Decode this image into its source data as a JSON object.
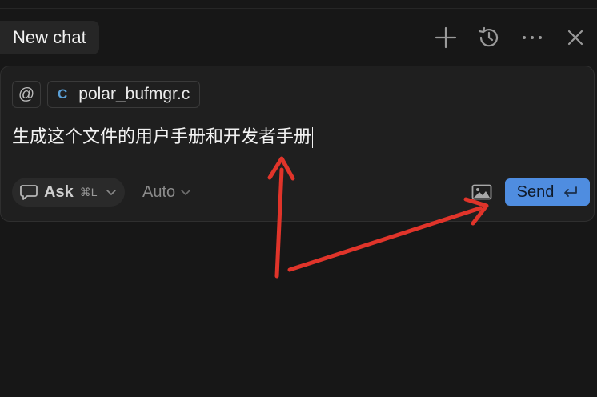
{
  "header": {
    "tab_label": "New chat"
  },
  "composer": {
    "mention_symbol": "@",
    "attached_file": {
      "icon_letter": "C",
      "name": "polar_bufmgr.c"
    },
    "prompt": "生成这个文件的用户手册和开发者手册",
    "mode": {
      "label": "Ask",
      "shortcut": "⌘L"
    },
    "model": {
      "label": "Auto"
    },
    "send": {
      "label": "Send"
    }
  },
  "colors": {
    "background": "#171717",
    "send_button": "#4f8de0",
    "annotation_arrow": "#e0342a",
    "file_icon": "#5a9fd6"
  },
  "icons": {
    "new_chat": "plus-icon",
    "history": "history-icon",
    "more": "ellipsis-icon",
    "close": "close-icon",
    "mode": "chat-bubble-icon",
    "image": "image-icon",
    "enter": "enter-icon"
  }
}
